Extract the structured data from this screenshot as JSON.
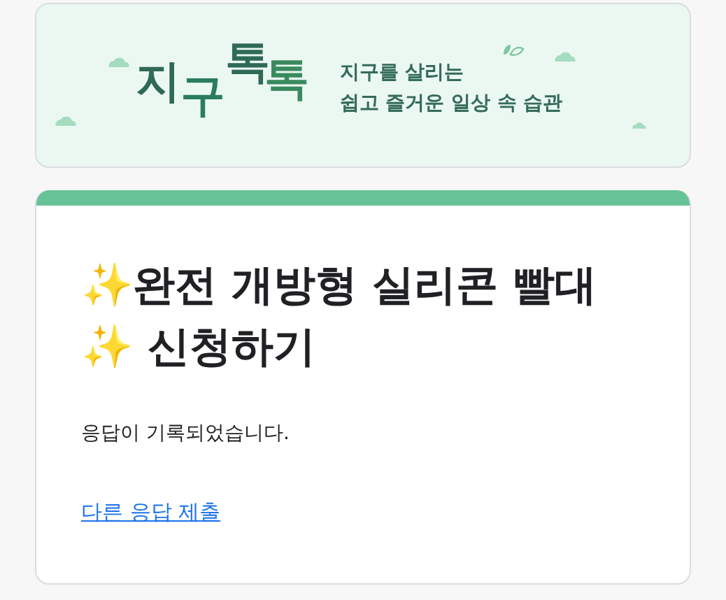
{
  "banner": {
    "logo": [
      "지",
      "구",
      "톡",
      "톡"
    ],
    "tagline": [
      "지구를 살리는",
      "쉽고 즐거운 일상 속 습관"
    ]
  },
  "form": {
    "title": "✨완전 개방형 실리콘 빨대✨ 신청하기",
    "message": "응답이 기록되었습니다.",
    "link": "다른 응답 제출"
  }
}
